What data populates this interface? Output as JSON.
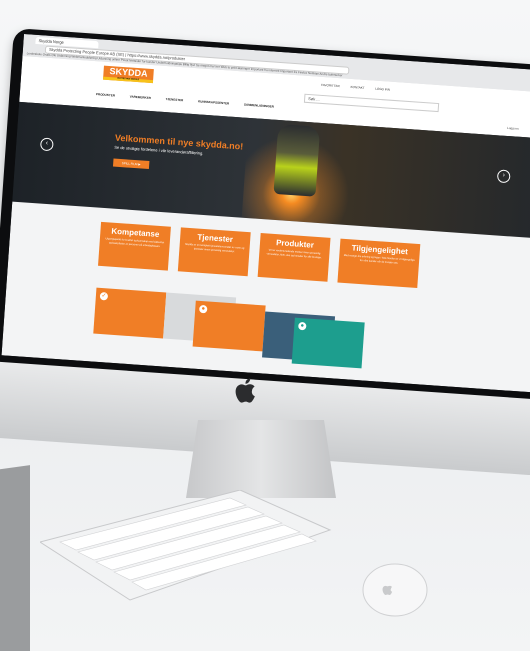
{
  "browser": {
    "tab_title": "Skydda Norge",
    "url": "Skydda Protecting People Europe AB (SE) | https://www.skydda.no/produkter",
    "bookmarks": "Lenkeskole  Gratis  Ole  Utdanning  Webmarkedsføring  Utdanning online  Privat  Nettsider for kunder  Underholdningstips  Billig flyvi  Se meget mer her  Web to print løsninger  Important fra internett  Important fra Firefox  Nettvise  Andre bokmerker"
  },
  "site": {
    "logo_text": "SKYDDA",
    "logo_tagline": "PROTECTING PEOPLE",
    "top_nav": [
      "FAVORITTER",
      "KONTAKT",
      "LOGG INN"
    ],
    "search_placeholder": "Søk ...",
    "main_nav": [
      "PRODUKTER",
      "VAREMERKER",
      "TJENESTER",
      "KUNNSKAPSSENTER",
      "SAMMENLIGNINGER"
    ],
    "login_status": "Logg inn"
  },
  "hero": {
    "heading": "Velkommen til nye skydda.no!",
    "subheading": "Se de utvalgte fordelene i vår leverandøraffiliering.",
    "cta_label": "SPILL FILM ▶",
    "prev_icon": "chevron-left-icon",
    "next_icon": "chevron-right-icon"
  },
  "cards": [
    {
      "title": "Kompetanse",
      "text": "Utgangspunkt for kvalitet og kunnskap med sikkerhet og beskyttelse av personer på arbeidsplassen."
    },
    {
      "title": "Tjenester",
      "text": "Skydda er en komplett tjenesteleverandør av varer og tjenester innen personlig verneutstyr."
    },
    {
      "title": "Produkter",
      "text": "Vi har verdens ledende merker innen personlig verneutstyr, klær, sko og hansker for alle bransjer."
    },
    {
      "title": "Tilgjengelighet",
      "text": "Med mange års erfaring og lager i hele Norden er vi tilgjengelige for våre kunder når de trenger oss."
    }
  ],
  "colors": {
    "brand_orange": "#f07e26",
    "brand_yellow": "#f7c21b",
    "teal": "#1d9e8e"
  }
}
